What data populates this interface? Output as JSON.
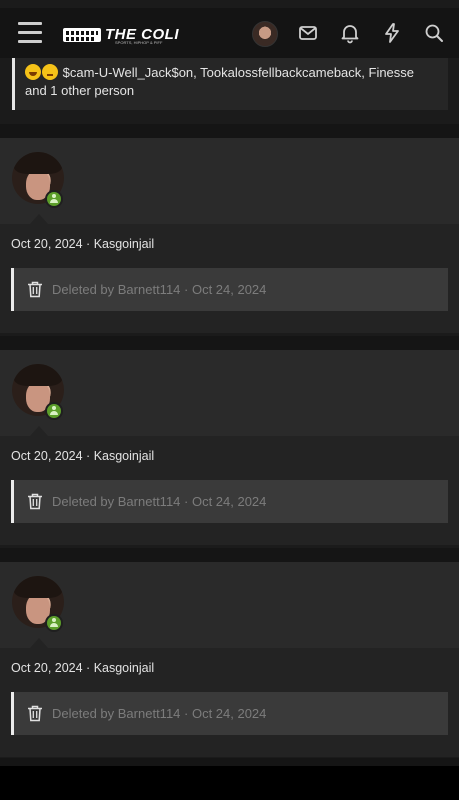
{
  "header": {
    "logo_text": "THE COLI",
    "logo_sub": "SPORTS, HIPHOP & PIFF"
  },
  "reactions": {
    "text": "$cam-U-Well_Jack$on, Tookalossfellbackcameback, Finesse and 1 other person"
  },
  "posts": [
    {
      "date": "Oct 20, 2024",
      "author": "Kasgoinjail",
      "deleted_text": "Deleted by Barnett114 · Oct 24, 2024"
    },
    {
      "date": "Oct 20, 2024",
      "author": "Kasgoinjail",
      "deleted_text": "Deleted by Barnett114 · Oct 24, 2024"
    },
    {
      "date": "Oct 20, 2024",
      "author": "Kasgoinjail",
      "deleted_text": "Deleted by Barnett114 · Oct 24, 2024"
    }
  ],
  "icons": [
    "menu-icon",
    "envelope-icon",
    "bell-icon",
    "bolt-icon",
    "search-icon",
    "trash-icon",
    "user-online-icon"
  ],
  "colors": {
    "online_badge": "#5c9e2a",
    "background": "#1b1b1b",
    "post_bg": "#2a2a2a"
  }
}
